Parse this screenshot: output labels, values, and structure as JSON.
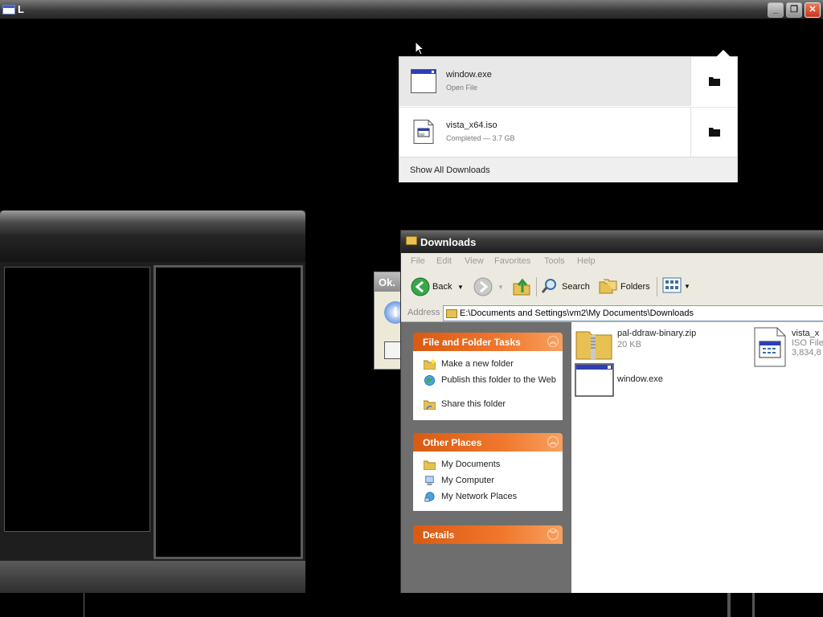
{
  "top_window": {
    "title": "L"
  },
  "download_popup": {
    "items": [
      {
        "name": "window.exe",
        "status": "Open File",
        "icon": "exe-window-icon"
      },
      {
        "name": "vista_x64.iso",
        "status": "Completed — 3.7 GB",
        "icon": "iso-file-icon"
      }
    ],
    "show_all": "Show All Downloads"
  },
  "msgbox": {
    "title": "Ok.",
    "icon_glyph": "i"
  },
  "explorer": {
    "title": "Downloads",
    "menu": [
      "File",
      "Edit",
      "View",
      "Favorites",
      "Tools",
      "Help"
    ],
    "toolbar": {
      "back": "Back",
      "search": "Search",
      "folders": "Folders"
    },
    "address_label": "Address",
    "address": "E:\\Documents and Settings\\vm2\\My Documents\\Downloads",
    "tasks": {
      "file_folder": {
        "title": "File and Folder Tasks",
        "items": [
          "Make a new folder",
          "Publish this folder to the Web",
          "Share this folder"
        ]
      },
      "other_places": {
        "title": "Other Places",
        "items": [
          "My Documents",
          "My Computer",
          "My Network Places"
        ]
      },
      "details": {
        "title": "Details"
      }
    },
    "files": [
      {
        "name": "pal-ddraw-binary.zip",
        "info": "20 KB"
      },
      {
        "name": "window.exe",
        "info": ""
      },
      {
        "name": "vista_x",
        "type": "ISO File",
        "info": "3,834,8"
      }
    ]
  }
}
